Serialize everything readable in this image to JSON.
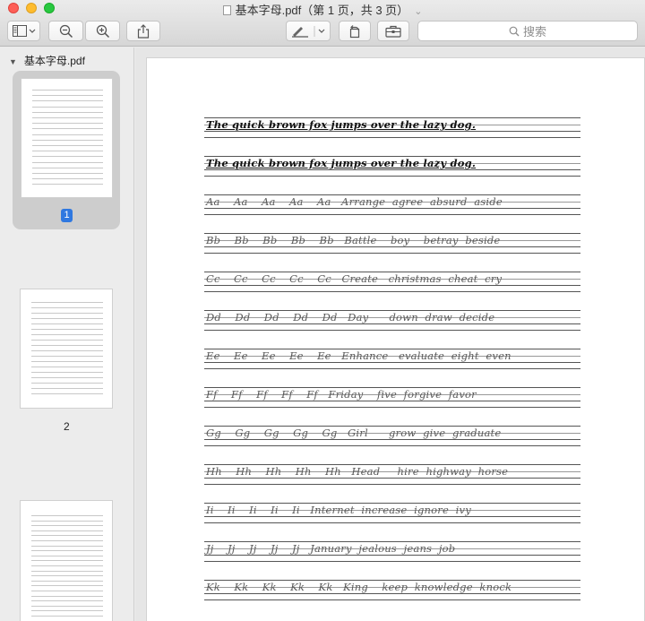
{
  "window": {
    "title": "基本字母.pdf（第 1 页，共 3 页）",
    "title_chevron": "⌄"
  },
  "toolbar": {
    "search_placeholder": "搜索",
    "buttons": [
      "sidebar-view",
      "zoom-out",
      "zoom-in",
      "share",
      "markup",
      "rotate",
      "toolbox"
    ]
  },
  "sidebar": {
    "file_name": "基本字母.pdf",
    "pages": [
      {
        "label": "1",
        "selected": true
      },
      {
        "label": "2",
        "selected": false
      },
      {
        "label": "",
        "selected": false
      }
    ]
  },
  "document": {
    "lines": [
      "The quick brown fox jumps over the lazy dog.",
      "The quick brown fox jumps over the lazy dog.",
      "Aa    Aa    Aa    Aa    Aa   Arrange  agree  absurd  aside",
      "Bb    Bb    Bb    Bb    Bb   Battle    boy    betray  beside",
      "Cc    Cc    Cc    Cc    Cc   Create   christmas  cheat  cry",
      "Dd    Dd    Dd    Dd    Dd   Day      down  draw  decide",
      "Ee    Ee    Ee    Ee    Ee   Enhance   evaluate  eight  even",
      "Ff    Ff    Ff    Ff    Ff   Friday    five  forgive  favor",
      "Gg    Gg    Gg    Gg    Gg   Girl      grow  give  graduate",
      "Hh    Hh    Hh    Hh    Hh   Head     hire  highway  horse",
      "Ii    Ii    Ii    Ii    Ii   Internet  increase  ignore  ivy",
      "Jj    Jj    Jj    Jj    Jj   January  jealous  jeans  job",
      "Kk    Kk    Kk    Kk    Kk   King    keep  knowledge  knock"
    ]
  }
}
